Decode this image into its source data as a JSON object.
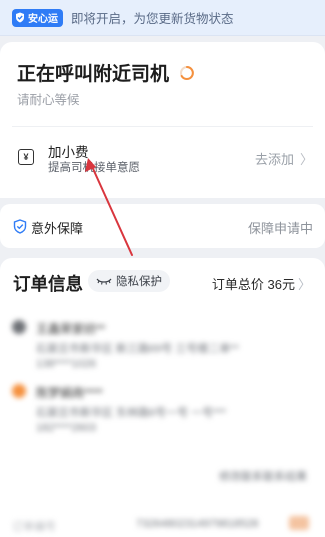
{
  "banner": {
    "badge_label": "安心运",
    "text": "即将开启，为您更新货物状态"
  },
  "status": {
    "title": "正在呼叫附近司机",
    "subtitle": "请耐心等候"
  },
  "tip": {
    "icon_glyph": "¥",
    "title": "加小费",
    "subtitle": "提高司机接单意愿",
    "action": "去添加",
    "action_icon": "chevron-right-icon"
  },
  "insurance": {
    "label": "意外保障",
    "status": "保障申请中"
  },
  "order": {
    "title": "订单信息",
    "privacy_label": "隐私保护",
    "total": "订单总价 36元",
    "blurred": {
      "sender_name": "王鑫荣家纺**",
      "sender_addr": "石家庄市新华区 新三路69号 三号楼二单**",
      "sender_phone": "138****1026",
      "receiver_name": "陈梦娟商****",
      "receiver_addr": "石家庄市新华区 东林路6号一号 一号***",
      "receiver_phone": "182****2603",
      "link": "修改联系联系结果",
      "order_no_label": "订单编号",
      "order_no": "73264802314979818528"
    }
  },
  "colors": {
    "accent": "#2f7cf6",
    "annotation_arrow": "#d9363e",
    "spinner": "#f5903d",
    "page_bg": "#eef0f4"
  }
}
